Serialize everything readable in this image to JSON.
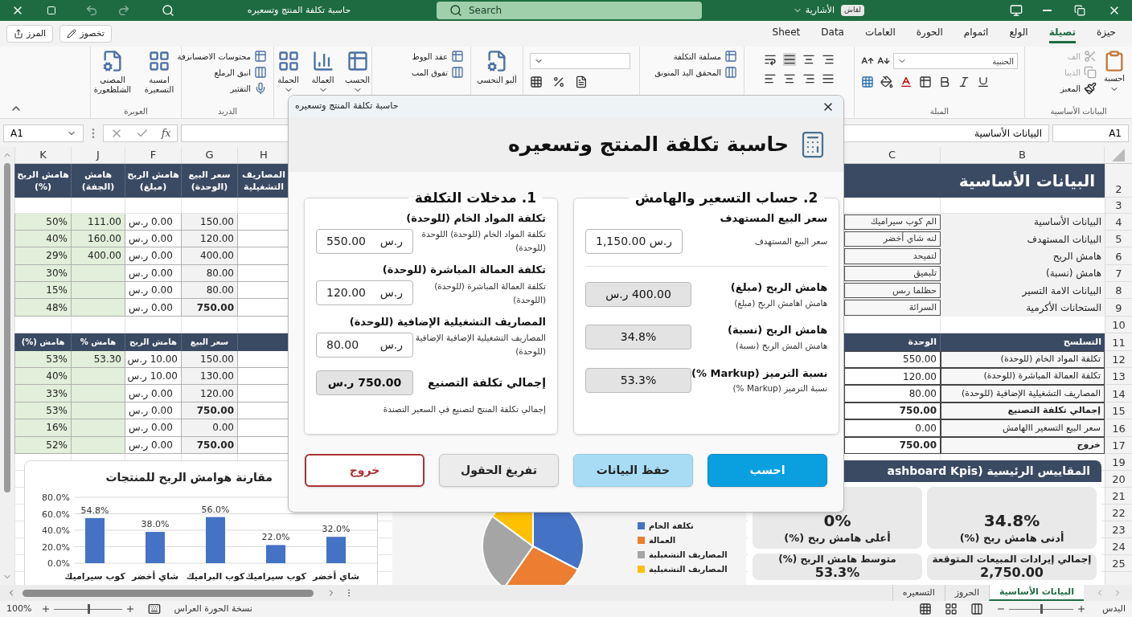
{
  "title_bar": {
    "title": "حاسبة تكلفة المنتج وتسعيره",
    "search_placeholder": "Search",
    "account": "الأشارية",
    "badge": "لقاش"
  },
  "ribbon": {
    "actions": [
      {
        "label": "تخصوز",
        "kind": "edit"
      },
      {
        "label": "المرز",
        "kind": "share"
      }
    ],
    "tabs": [
      {
        "label": "حيزة",
        "selected": false
      },
      {
        "label": "تصيلة",
        "selected": true
      },
      {
        "label": "الولع",
        "selected": false
      },
      {
        "label": "اثموام",
        "selected": false
      },
      {
        "label": "الحورة",
        "selected": false
      },
      {
        "label": "العامات",
        "selected": false
      },
      {
        "label": "Data",
        "selected": false
      },
      {
        "label": "Sheet",
        "selected": false
      }
    ],
    "groups": [
      {
        "kind": "clipboard",
        "label": "البيانات الأساسية",
        "paste": "احسبة",
        "items": [
          {
            "label": "الف",
            "disabled": true
          },
          {
            "label": "الذيبا",
            "disabled": true
          },
          {
            "label": "المعبز",
            "disabled": false
          }
        ]
      },
      {
        "kind": "font",
        "label": "المبلة",
        "font": "الحنبية"
      },
      {
        "kind": "align"
      },
      {
        "kind": "list",
        "buttons": [
          "مسلفة التكلفة",
          "المحقق اليد المنونق"
        ]
      },
      {
        "kind": "number"
      },
      {
        "kind": "large",
        "menu": false,
        "buttons": [
          "ألبو التحسى"
        ]
      },
      {
        "kind": "list",
        "buttons": [
          "عقد الووط",
          "تفوق المب"
        ]
      },
      {
        "kind": "large",
        "menu": true,
        "buttons": [
          "الحسب",
          "العمالة",
          "الحملة"
        ]
      },
      {
        "kind": "list",
        "label": "الدريد",
        "buttons": [
          "محتوسات الاضسانزفة",
          "انبق الرملع",
          "التقثير"
        ]
      },
      {
        "kind": "large",
        "label": "العوبرة",
        "menu": false,
        "buttons": [
          "امسبة التسعيرة",
          "المصنى الشلظعورة"
        ]
      }
    ]
  },
  "formula_bar": {
    "function_label": "fx",
    "name_box_left": "A1",
    "name_box_right": "A1",
    "formula": "البيانات الأساسية"
  },
  "sheet": {
    "column_letters_left": [
      "H",
      "G",
      "F",
      "J",
      "K"
    ],
    "column_letters_right": [
      "B",
      "C"
    ],
    "row_numbers": [
      "2",
      "3",
      "4",
      "5",
      "6",
      "7",
      "8",
      "9",
      "10",
      "11",
      "12",
      "13",
      "14",
      "15",
      "16",
      "17",
      "19",
      "20",
      "21",
      "22",
      "23",
      "24",
      "25"
    ],
    "title": "البيانات الأساسية",
    "products_header": [
      "المصاريف التشغيلية",
      "سعر البيع (الوحدة)",
      "هامش الربح (مبلغ)",
      "هامش (الجفة)",
      "هامش الربح (%)"
    ],
    "products": [
      {
        "k": "50%",
        "j": "111.00",
        "f": "0.00 ر.س",
        "g": "150.00",
        "total": false
      },
      {
        "k": "40%",
        "j": "160.00",
        "f": "0.00 ر.س",
        "g": "120.00",
        "total": false
      },
      {
        "k": "29%",
        "j": "400.00",
        "f": "0.00 ر.س",
        "g": "400.00",
        "total": false
      },
      {
        "k": "30%",
        "f": "0.00 ر.س",
        "g": "80.00",
        "total": false
      },
      {
        "k": "15%",
        "f": "0.00 ر.س",
        "g": "80.00",
        "total": false
      },
      {
        "k": "48%",
        "f": "0.00 ر.س",
        "g": "750.00",
        "total": true
      }
    ],
    "margins_header": [
      "سعر البيع",
      "هامش الربح",
      "هامش %",
      "هامش (%)"
    ],
    "margins": [
      {
        "k": "53%",
        "j": "53.30",
        "f": "10.00 ر.س",
        "g": "150.00",
        "total": false
      },
      {
        "k": "40%",
        "f": "10.00 ر.س",
        "g": "130.00",
        "total": false
      },
      {
        "k": "33%",
        "f": "0.00 ر.س",
        "g": "120.00",
        "total": false
      },
      {
        "k": "53%",
        "f": "0.00 ر.س",
        "g": "750.00",
        "total": true
      },
      {
        "k": "16%",
        "f": "0.00 ر.س",
        "g": "0.00",
        "total": false
      },
      {
        "k": "52%",
        "f": "0.00 ر.س",
        "g": "750.00",
        "total": true
      }
    ],
    "info": [
      {
        "label": "البيانات الأساسية",
        "value": "الم كوب سيراميك"
      },
      {
        "label": "البيانات المستهدف",
        "value": "لنه شاي أخضر"
      },
      {
        "label": "هامش الربح",
        "value": "لتميحد"
      },
      {
        "label": "هامش (نسبة)",
        "value": "تلبميق"
      },
      {
        "label": "البيانات الامة التسير",
        "value": "حظلما رىس"
      },
      {
        "label": "الستحانات الأكرمية",
        "value": "السرائة"
      }
    ],
    "cost_header": {
      "label": "التسلسح",
      "value": "الوحدة"
    },
    "costs": [
      {
        "label": "تكلفة المواد الخام (للوحدة)",
        "value": "550.00",
        "total": false
      },
      {
        "label": "تكلفة العمالة المباشرة (للوحدة)",
        "value": "120.00",
        "total": false
      },
      {
        "label": "المصاريف التشغيلية الإضافية (للوحدة)",
        "value": "80.00",
        "total": false
      },
      {
        "label": "إجمالي تكلفة التصنيع",
        "value": "750.00",
        "total": true
      },
      {
        "label": "سعر البيع التسعير االهامش",
        "value": "0.00",
        "total": false
      },
      {
        "label": "خروج",
        "value": "750.00",
        "total": true
      }
    ]
  },
  "bar_chart": {
    "chart_data": {
      "type": "bar",
      "title": "مقارنة هوامش الربح للمنتجات",
      "categories": [
        "كوب سيراميك",
        "شاي أخضر",
        "كوب البراميك",
        "كوب سيراميك",
        "شاي أخضر"
      ],
      "series": [
        {
          "color": "#4472c4",
          "values": [
            54.8,
            38.0,
            56.0,
            22.0,
            32.0
          ]
        }
      ],
      "ylim": [
        0,
        80
      ],
      "yticks": [
        {
          "value": 0,
          "label": "0.0%"
        },
        {
          "value": 20,
          "label": "20.0%"
        },
        {
          "value": 40,
          "label": "40.0%"
        },
        {
          "value": 60,
          "label": "60.0%"
        },
        {
          "value": 80,
          "label": "80.0%"
        }
      ],
      "grid": true,
      "value_labels": [
        "54.8%",
        "38.0%",
        "56.0%",
        "22.0%",
        "32.0%"
      ]
    }
  },
  "pie_chart": {
    "legend": [
      {
        "label": "تكلفة الخام",
        "color": "#4472c4"
      },
      {
        "label": "العمالة",
        "color": "#ed7d31"
      },
      {
        "label": "المصاريف التشغيلية",
        "color": "#a5a5a5"
      },
      {
        "label": "المصاريف التشغيلية",
        "color": "#ffc000"
      }
    ]
  },
  "kpis": {
    "title": "المقاييس الرئيسية (ashboard Kpis",
    "cards": [
      {
        "label": "أدنى هامش ربح (%)",
        "value": "34.8%",
        "value_first": true
      },
      {
        "label": "أعلى هامش ربح (%)",
        "value": "0%",
        "value_first": true
      },
      {
        "label": "إجمالي إيرادات المبيعات المتوقعة",
        "value": "2,750.00",
        "value_first": false
      },
      {
        "label": "متوسط هامش الربح (%)",
        "value": "53.3%",
        "value_first": false
      }
    ]
  },
  "dialog": {
    "window_title": "حاسبة تكلفة المنتج وتسعيره",
    "heading": "حاسبة تكلفة المنتج وتسعيره",
    "costs": {
      "title": "1. مدخلات التكلفة",
      "inputs": [
        {
          "label": "تكلفة المواد الخام (للوحدة)",
          "hint": "تكلفة المواد الخام (للوحدة) اللوحدة (للوحدة)",
          "value": "550.00",
          "unit": "ر.س"
        },
        {
          "label": "تكلفة العمالة المباشرة (للوحدة)",
          "hint": "تكلفة العمالة المباشرة (للوحدة) (اللوحدة)",
          "value": "120.00",
          "unit": "ر.س"
        },
        {
          "label": "المصاريف التشغيلية الإضافية (للوحدة)",
          "hint": "المصاريف التشغيلية الإضافية الإضافية (للوحدة)",
          "value": "80.00",
          "unit": "ر.س"
        }
      ],
      "total": {
        "label": "إجمالي تكلفة التصنيع",
        "value": "750.00 ر.س",
        "note": "إجمالي تكلفة المنتج لتصنيع في السعير التصندة"
      }
    },
    "pricing": {
      "title": "2. حساب التسعير والهامش",
      "target": {
        "label": "سعر البيع المستهدف",
        "hint": "سعر البيع المستهدف",
        "value": "1,150.00",
        "unit": "ر.س"
      },
      "results": [
        {
          "label": "هامش الربح (مبلغ)",
          "hint": "هامش اهامش الربح (مبلغ)",
          "value": "400.00 ر.س"
        },
        {
          "label": "هامش الربح (نسبة)",
          "hint": "هامش المش الربح (نسبة)",
          "value": "34.8%"
        },
        {
          "label": "نسبة الترميز (Markup %)",
          "hint": "نسبة الترميز (Markup %)",
          "value": "53.3%"
        }
      ]
    },
    "buttons": [
      {
        "label": "احسب",
        "kind": "primary"
      },
      {
        "label": "حفظ البيانات",
        "kind": "save"
      },
      {
        "label": "تفريغ الحقول",
        "kind": "clear"
      },
      {
        "label": "خروج",
        "kind": "exit"
      }
    ]
  },
  "sheet_tabs": [
    {
      "label": "البيانات الأساسية",
      "selected": true
    },
    {
      "label": "الحروز",
      "selected": false
    },
    {
      "label": "التسعيره",
      "selected": false
    }
  ],
  "status_bar": {
    "zoom": "100%",
    "left_text": "نسخة الحورة العراس",
    "right_text": "البدس",
    "zoom_sliders": [
      {
        "level": 0.5
      },
      {
        "level": 0.5
      }
    ]
  }
}
